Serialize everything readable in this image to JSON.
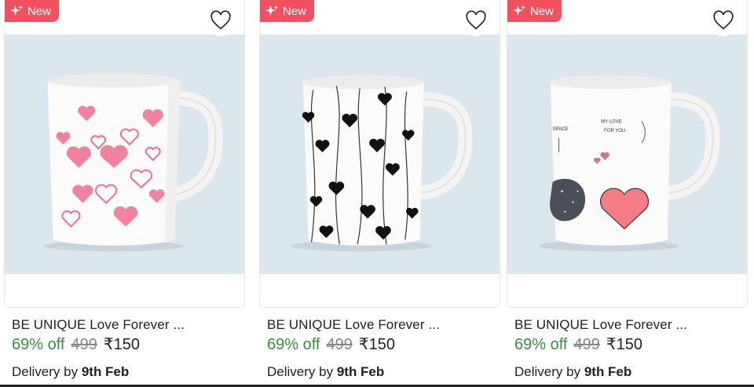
{
  "products": [
    {
      "badge": "New",
      "title": "BE UNIQUE Love Forever ...",
      "discount": "69% off",
      "mrp": "499",
      "price": "₹150",
      "delivery_prefix": "Delivery by",
      "delivery_date": "9th Feb"
    },
    {
      "badge": "New",
      "title": "BE UNIQUE Love Forever ...",
      "discount": "69% off",
      "mrp": "499",
      "price": "₹150",
      "delivery_prefix": "Delivery by",
      "delivery_date": "9th Feb"
    },
    {
      "badge": "New",
      "title": "BE UNIQUE Love Forever ...",
      "discount": "69% off",
      "mrp": "499",
      "price": "₹150",
      "delivery_prefix": "Delivery by",
      "delivery_date": "9th Feb",
      "mug_text": {
        "left": "SPACE",
        "right_line1": "MY LOVE",
        "right_line2": "FOR YOU"
      }
    }
  ],
  "icons": {
    "badge": "sparkle-icon",
    "wishlist": "heart-outline-icon"
  },
  "colors": {
    "badge": "#f1505f",
    "discount": "#388e3c",
    "mrp": "#878787",
    "image_bg": "#dbe6ed"
  }
}
